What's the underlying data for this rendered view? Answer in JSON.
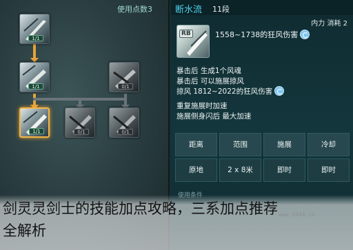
{
  "skill_tree": {
    "points_label": "使用点数3",
    "nodes": [
      {
        "id": "r1c1",
        "level": "1/1",
        "state": "learned"
      },
      {
        "id": "r2c1",
        "level": "1/1",
        "state": "learned"
      },
      {
        "id": "r2c3",
        "level": "0/1",
        "state": "locked"
      },
      {
        "id": "r3c1",
        "level": "1/1",
        "state": "selected"
      },
      {
        "id": "r3c2",
        "level": "0/1",
        "state": "locked"
      },
      {
        "id": "r3c3",
        "level": "0/1",
        "state": "locked"
      }
    ]
  },
  "skill_detail": {
    "name": "断水流",
    "level": "11段",
    "cost": "内力 消耗 2",
    "icon_tag": "RB",
    "damage": "1558~1738的狂风伤害",
    "effects": [
      "暴击后 生成1个风魂",
      "暴击后 可以施展掠风",
      "掠风 1812~2022的狂风伤害",
      "重复施展时加速",
      "施展侧身闪后 最大加速"
    ],
    "stats": {
      "headers": [
        "距离",
        "范围",
        "施展",
        "冷却"
      ],
      "values": [
        "原地",
        "2 x 8米",
        "即时",
        "即时"
      ]
    },
    "requirement_label": "使用条件"
  },
  "caption": {
    "line1": "剑灵灵剑士的技能加点攻略，三系加点推荐",
    "line2": "全解析"
  },
  "watermark": "www.X444.cn",
  "colors": {
    "link": "#e6a33a",
    "skill_name": "#4fd3ee",
    "panel_bg": "#13363c"
  }
}
